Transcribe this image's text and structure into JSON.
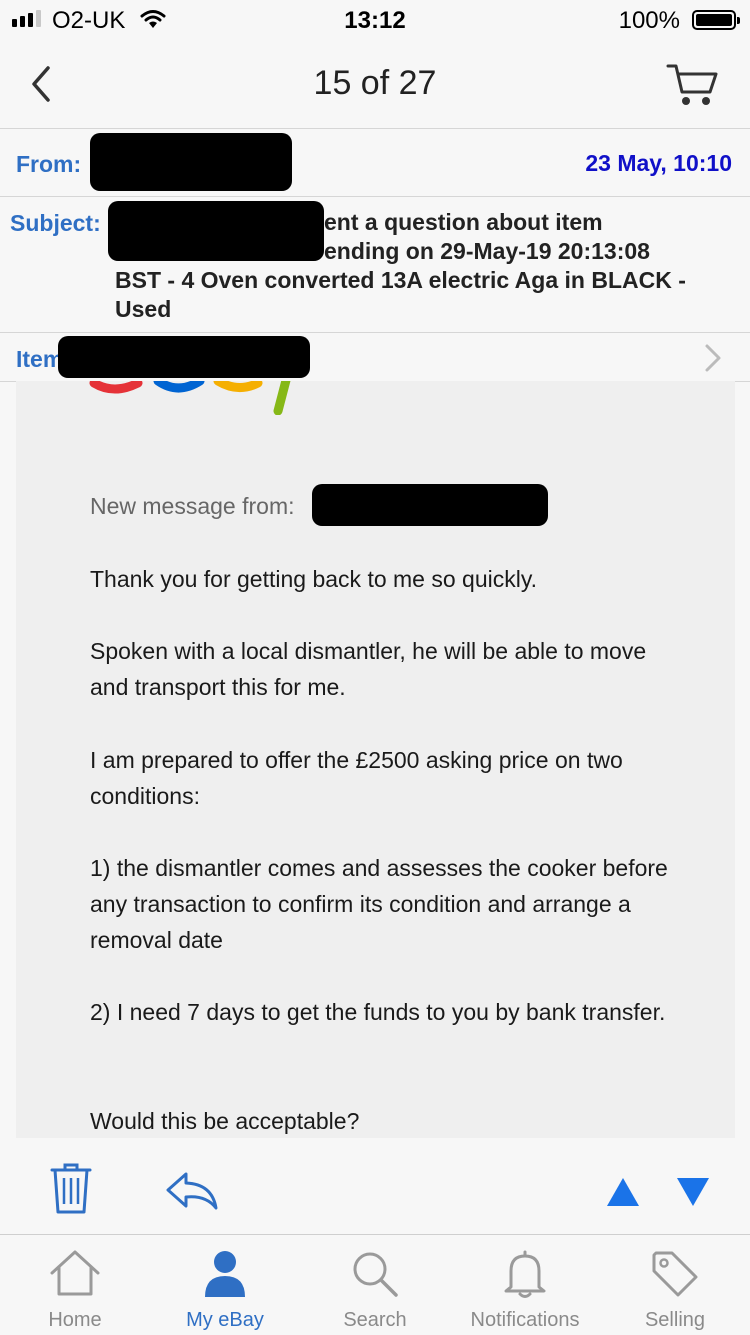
{
  "status_bar": {
    "carrier": "O2-UK",
    "time": "13:12",
    "battery": "100%"
  },
  "nav": {
    "title": "15 of 27"
  },
  "header": {
    "from_label": "From:",
    "date": "23 May, 10:10",
    "subject_label": "Subject:",
    "subject_lines": [
      "ent a question about item",
      "ending on 29-May-19 20:13:08",
      "BST - 4 Oven converted 13A electric Aga in BLACK -",
      "Used"
    ],
    "item_label": "Item"
  },
  "message": {
    "from_label": "New message from:",
    "paragraphs": [
      "Thank you for getting back to me so quickly.",
      "Spoken with a local dismantler, he will be able to move and transport this for me.",
      "I am prepared to offer the £2500 asking price on two conditions:",
      "1) the dismantler comes and assesses the cooker before any transaction to confirm its condition and arrange a removal date",
      "2) I need 7 days to get the funds to you by bank transfer.",
      "Would this be acceptable?"
    ]
  },
  "tabs": [
    {
      "label": "Home",
      "icon": "home-icon"
    },
    {
      "label": "My eBay",
      "icon": "person-icon"
    },
    {
      "label": "Search",
      "icon": "search-icon"
    },
    {
      "label": "Notifications",
      "icon": "bell-icon"
    },
    {
      "label": "Selling",
      "icon": "tag-icon"
    }
  ],
  "colors": {
    "accent": "#2f6fc4",
    "date": "#1010c8",
    "active_tab": "#2f6fc4"
  }
}
